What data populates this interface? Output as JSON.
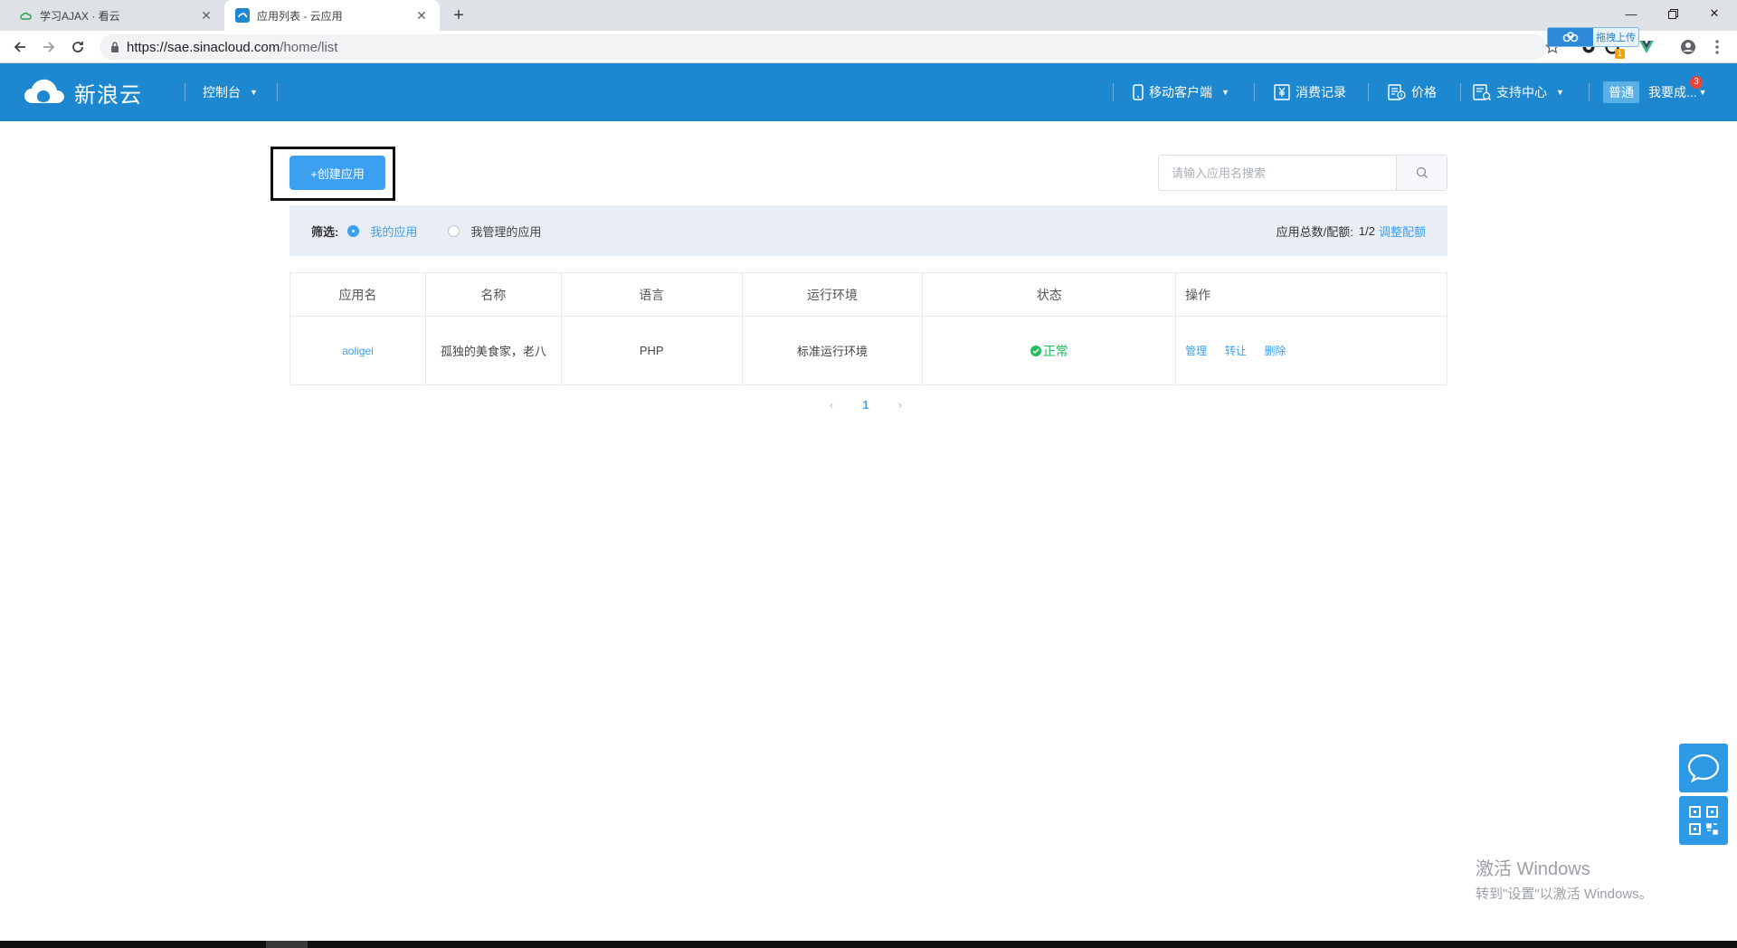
{
  "browser": {
    "tabs": [
      {
        "title": "学习AJAX · 看云",
        "active": false
      },
      {
        "title": "应用列表 - 云应用",
        "active": true
      }
    ],
    "url_host": "https://sae.sinacloud.com",
    "url_path": "/home/list",
    "upload_button_label": "拖拽上传",
    "extension_badge": "1"
  },
  "header": {
    "logo_text": "新浪云",
    "console_label": "控制台",
    "mobile_label": "移动客户端",
    "consumption_label": "消费记录",
    "price_label": "价格",
    "support_label": "支持中心",
    "plan_badge": "普通",
    "user_label": "我要成...",
    "notification_count": "3"
  },
  "toolbar": {
    "create_label": "+创建应用",
    "search_placeholder": "请输入应用名搜索"
  },
  "filter": {
    "label": "筛选:",
    "options": [
      "我的应用",
      "我管理的应用"
    ],
    "selected": "我的应用",
    "quota_label": "应用总数/配额:",
    "quota_value": "1/2",
    "adjust_label": "调整配额"
  },
  "table": {
    "headers": [
      "应用名",
      "名称",
      "语言",
      "运行环境",
      "状态",
      "操作"
    ],
    "rows": [
      {
        "app": "aoligei",
        "name": "孤独的美食家，老八",
        "language": "PHP",
        "runtime": "标准运行环境",
        "status": "正常",
        "ops": [
          "管理",
          "转让",
          "删除"
        ]
      }
    ]
  },
  "pagination": {
    "prev": "‹",
    "current": "1",
    "next": "›"
  },
  "watermark": {
    "line1": "激活 Windows",
    "line2": "转到\"设置\"以激活 Windows。"
  },
  "colors": {
    "header_bg": "#1d88d0",
    "primary": "#3ba0f0",
    "success": "#1fbe5b"
  }
}
